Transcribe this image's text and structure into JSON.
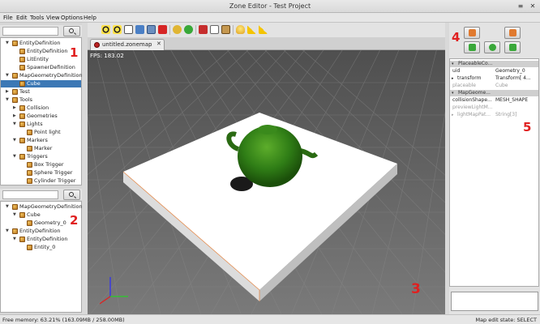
{
  "window": {
    "title": "Zone Editor - Test Project",
    "menu_label": "≡",
    "close_label": "✕"
  },
  "menu": [
    "File",
    "Edit",
    "Tools",
    "View",
    "Options",
    "Help"
  ],
  "toolbar": {
    "icons": [
      "radiation-icon",
      "radiation-icon",
      "document-icon",
      "open-folder-icon",
      "save-icon",
      "close-red-icon",
      "redo-icon",
      "redo-green-icon",
      "cut-icon",
      "copy-icon",
      "paste-icon",
      "bulb-icon",
      "warning-icon",
      "radiation-warning-icon"
    ]
  },
  "top_tree": {
    "items": [
      {
        "label": "EntityDefinition",
        "depth": 0,
        "arrow": "▼"
      },
      {
        "label": "EntityDefinition",
        "depth": 1,
        "arrow": ""
      },
      {
        "label": "LitEntity",
        "depth": 1,
        "arrow": ""
      },
      {
        "label": "SpawnerDefinition",
        "depth": 1,
        "arrow": ""
      },
      {
        "label": "MapGeometryDefinition",
        "depth": 0,
        "arrow": "▼"
      },
      {
        "label": "Cube",
        "depth": 1,
        "arrow": "",
        "selected": true
      },
      {
        "label": "Test",
        "depth": 0,
        "arrow": "▶"
      },
      {
        "label": "Tools",
        "depth": 0,
        "arrow": "▼"
      },
      {
        "label": "Collision",
        "depth": 1,
        "arrow": "▶"
      },
      {
        "label": "Geometries",
        "depth": 1,
        "arrow": "▶"
      },
      {
        "label": "Lights",
        "depth": 1,
        "arrow": "▼"
      },
      {
        "label": "Point light",
        "depth": 2,
        "arrow": ""
      },
      {
        "label": "Markers",
        "depth": 1,
        "arrow": "▼"
      },
      {
        "label": "Marker",
        "depth": 2,
        "arrow": ""
      },
      {
        "label": "Triggers",
        "depth": 1,
        "arrow": "▼"
      },
      {
        "label": "Box Trigger",
        "depth": 2,
        "arrow": ""
      },
      {
        "label": "Sphere Trigger",
        "depth": 2,
        "arrow": ""
      },
      {
        "label": "Cylinder Trigger",
        "depth": 2,
        "arrow": ""
      }
    ]
  },
  "bottom_tree": {
    "items": [
      {
        "label": "MapGeometryDefinition",
        "depth": 0,
        "arrow": "▼"
      },
      {
        "label": "Cube",
        "depth": 1,
        "arrow": "▼"
      },
      {
        "label": "Geometry_0",
        "depth": 2,
        "arrow": ""
      },
      {
        "label": "EntityDefinition",
        "depth": 0,
        "arrow": "▼"
      },
      {
        "label": "EntityDefinition",
        "depth": 1,
        "arrow": "▼"
      },
      {
        "label": "Entity_0",
        "depth": 2,
        "arrow": ""
      }
    ]
  },
  "annotations": {
    "one": "1",
    "two": "2",
    "three": "3",
    "four": "4",
    "five": "5"
  },
  "tab": {
    "label": "untitled.zonemap",
    "close": "✕"
  },
  "viewport": {
    "fps": "FPS: 183.02"
  },
  "properties": [
    {
      "type": "header",
      "key": "PlaceableCo..."
    },
    {
      "type": "row",
      "key": "uid",
      "value": "Geometry_0"
    },
    {
      "type": "row",
      "key": "transform",
      "value": "Transform[ 4...",
      "tri": "▸"
    },
    {
      "type": "row",
      "key": "placeable",
      "value": "Cube",
      "disabled": true
    },
    {
      "type": "header",
      "key": "MapGeome..."
    },
    {
      "type": "row",
      "key": "collisionShape...",
      "value": "MESH_SHAPE"
    },
    {
      "type": "row",
      "key": "previewLightM...",
      "value": "",
      "disabled": true
    },
    {
      "type": "row",
      "key": "lightMapPat...",
      "value": "String[3]",
      "disabled": true,
      "tri": "▸"
    }
  ],
  "statusbar": {
    "memory": "Free memory: 63.21% (163.09MB / 258.00MB)",
    "state": "Map edit state: SELECT"
  }
}
